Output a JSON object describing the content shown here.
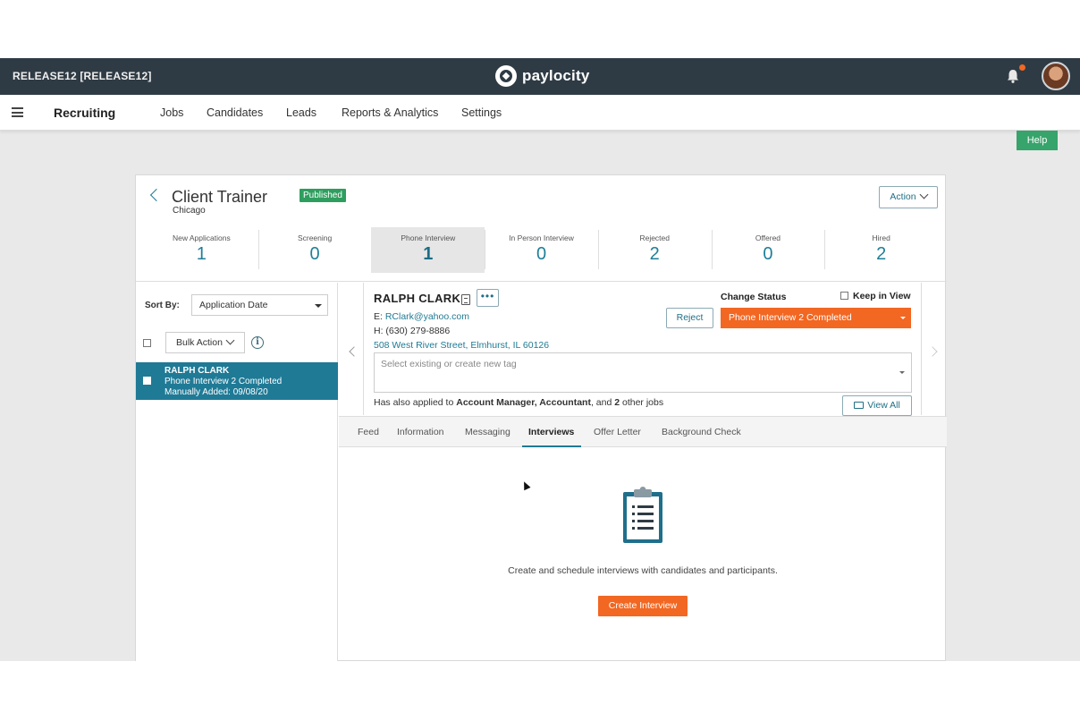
{
  "topbar": {
    "environment": "RELEASE12 [RELEASE12]",
    "brand": "paylocity",
    "bell_icon": "bell-icon",
    "avatar_icon": "user-avatar"
  },
  "nav": {
    "title": "Recruiting",
    "items": [
      "Jobs",
      "Candidates",
      "Leads",
      "Reports & Analytics",
      "Settings"
    ],
    "help": "Help"
  },
  "job": {
    "title": "Client Trainer",
    "location": "Chicago",
    "badge": "Published",
    "action_label": "Action"
  },
  "stages": [
    {
      "label": "New Applications",
      "count": "1"
    },
    {
      "label": "Screening",
      "count": "0"
    },
    {
      "label": "Phone Interview",
      "count": "1"
    },
    {
      "label": "In Person Interview",
      "count": "0"
    },
    {
      "label": "Rejected",
      "count": "2"
    },
    {
      "label": "Offered",
      "count": "0"
    },
    {
      "label": "Hired",
      "count": "2"
    }
  ],
  "list": {
    "sort_label": "Sort By:",
    "sort_value": "Application Date",
    "bulk_action": "Bulk Action",
    "items": [
      {
        "name": "RALPH CLARK",
        "status": "Phone Interview 2 Completed",
        "added": "Manually Added: 09/08/20"
      }
    ]
  },
  "candidate": {
    "name": "RALPH CLARK",
    "more": "•••",
    "email_prefix": "E: ",
    "email": "RClark@yahoo.com",
    "phone": "H: (630) 279-8886",
    "address": "508 West River Street, Elmhurst, IL 60126",
    "change_status_label": "Change Status",
    "keep_in_view": "Keep in View",
    "reject": "Reject",
    "status": "Phone Interview 2 Completed",
    "tag_placeholder": "Select existing or create new tag",
    "also_applied_prefix": "Has also applied to ",
    "also_applied_jobs": "Account Manager, Accountant",
    "also_applied_mid": ", and ",
    "also_applied_count": "2",
    "also_applied_suffix": " other jobs",
    "view_all": "View All"
  },
  "tabs": [
    "Feed",
    "Information",
    "Messaging",
    "Interviews",
    "Offer Letter",
    "Background Check"
  ],
  "interviews": {
    "empty_text": "Create and schedule interviews with candidates and participants.",
    "create_button": "Create Interview"
  },
  "colors": {
    "topbar": "#2f3b44",
    "accent_teal": "#1f7a96",
    "accent_orange": "#f26722",
    "published_green": "#2e9e5e",
    "help_green": "#36a46b"
  }
}
